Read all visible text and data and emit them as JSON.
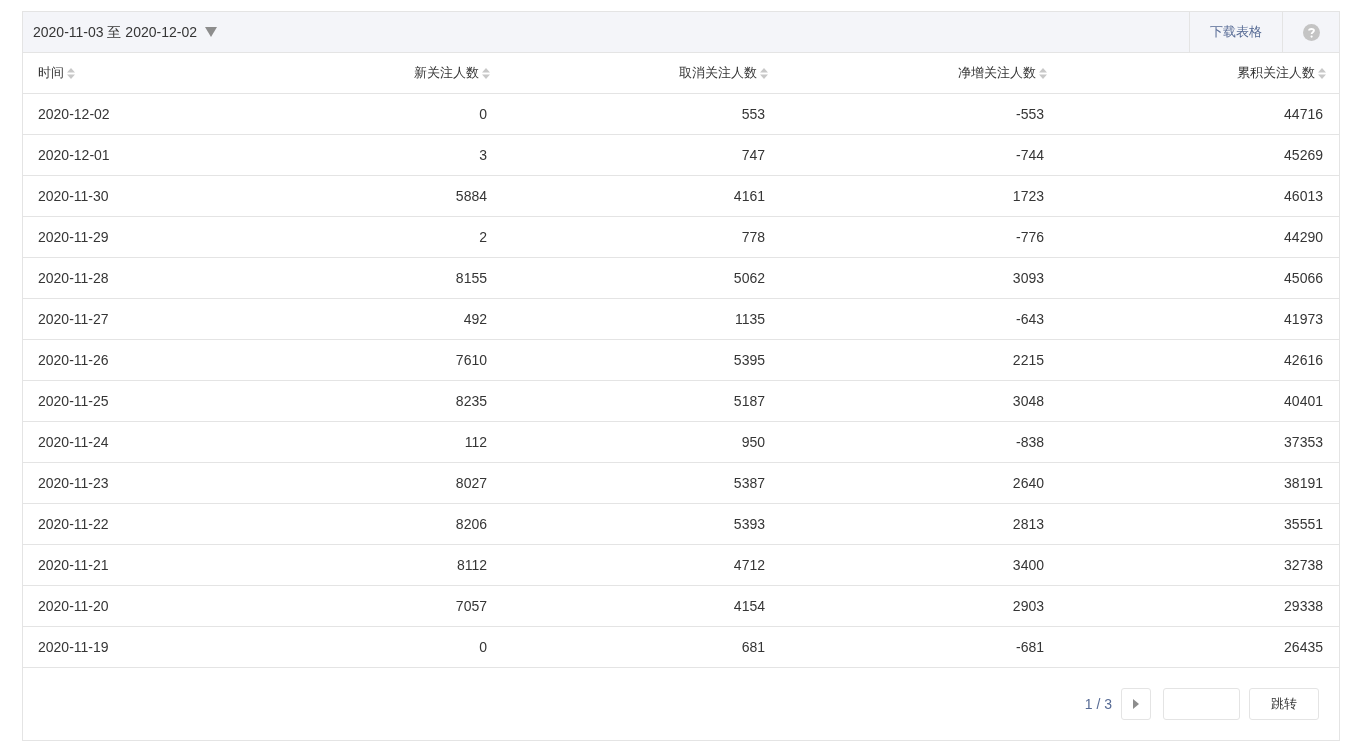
{
  "toolbar": {
    "date_range": "2020-11-03 至 2020-12-02",
    "download": "下载表格"
  },
  "table": {
    "columns": [
      "时间",
      "新关注人数",
      "取消关注人数",
      "净增关注人数",
      "累积关注人数"
    ],
    "rows": [
      [
        "2020-12-02",
        "0",
        "553",
        "-553",
        "44716"
      ],
      [
        "2020-12-01",
        "3",
        "747",
        "-744",
        "45269"
      ],
      [
        "2020-11-30",
        "5884",
        "4161",
        "1723",
        "46013"
      ],
      [
        "2020-11-29",
        "2",
        "778",
        "-776",
        "44290"
      ],
      [
        "2020-11-28",
        "8155",
        "5062",
        "3093",
        "45066"
      ],
      [
        "2020-11-27",
        "492",
        "1135",
        "-643",
        "41973"
      ],
      [
        "2020-11-26",
        "7610",
        "5395",
        "2215",
        "42616"
      ],
      [
        "2020-11-25",
        "8235",
        "5187",
        "3048",
        "40401"
      ],
      [
        "2020-11-24",
        "112",
        "950",
        "-838",
        "37353"
      ],
      [
        "2020-11-23",
        "8027",
        "5387",
        "2640",
        "38191"
      ],
      [
        "2020-11-22",
        "8206",
        "5393",
        "2813",
        "35551"
      ],
      [
        "2020-11-21",
        "8112",
        "4712",
        "3400",
        "32738"
      ],
      [
        "2020-11-20",
        "7057",
        "4154",
        "2903",
        "29338"
      ],
      [
        "2020-11-19",
        "0",
        "681",
        "-681",
        "26435"
      ]
    ]
  },
  "pagination": {
    "page": "1 / 3",
    "jump": "跳转"
  }
}
